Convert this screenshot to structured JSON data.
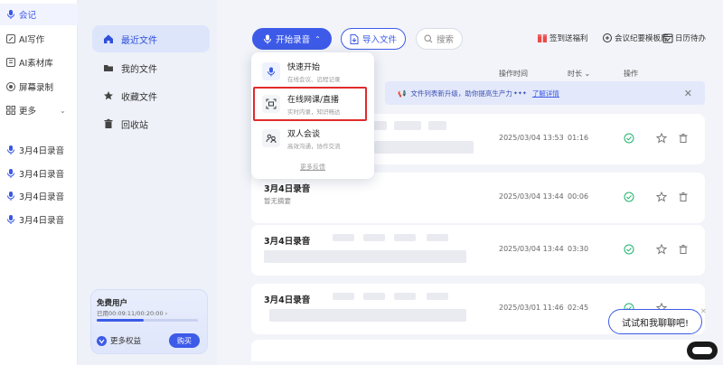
{
  "nav": {
    "items": [
      {
        "label": "会记",
        "icon": "mic-icon"
      },
      {
        "label": "AI写作",
        "icon": "edit-icon"
      },
      {
        "label": "AI素材库",
        "icon": "library-icon"
      },
      {
        "label": "屏幕录制",
        "icon": "record-icon"
      },
      {
        "label": "更多",
        "icon": "grid-icon"
      }
    ],
    "recordings": [
      "3月4日录音",
      "3月4日录音",
      "3月4日录音",
      "3月4日录音"
    ]
  },
  "col2": {
    "items": [
      {
        "label": "最近文件",
        "icon": "home-icon"
      },
      {
        "label": "我的文件",
        "icon": "folder-icon"
      },
      {
        "label": "收藏文件",
        "icon": "star-icon"
      },
      {
        "label": "回收站",
        "icon": "trash-icon"
      }
    ],
    "free_card": {
      "title": "免费用户",
      "usage": "已用00:09:11/00:20:00 ›",
      "usage_fraction": 0.46,
      "rights_label": "更多权益",
      "buy_label": "购买"
    }
  },
  "toolbar": {
    "record_label": "开始录音",
    "import_label": "导入文件",
    "search_placeholder": "搜索",
    "links": [
      "签到送福利",
      "会议纪要模板库",
      "日历待办"
    ]
  },
  "table": {
    "headers": {
      "time": "操作时间",
      "duration": "时长",
      "ops": "操作"
    }
  },
  "notice": {
    "text": "文件列表新升级，助你提高生产力",
    "link": "了解详情"
  },
  "dropdown": {
    "items": [
      {
        "title": "快速开始",
        "subtitle": "在线会议、远程记录"
      },
      {
        "title": "在线网课/直播",
        "subtitle": "实时内录，知识畅达"
      },
      {
        "title": "双人会谈",
        "subtitle": "高效沟通，协作交流"
      }
    ],
    "feedback": "更多反馈"
  },
  "rows": [
    {
      "title": "",
      "subtitle": "",
      "date": "2025/03/04 13:53",
      "duration": "01:16"
    },
    {
      "title": "3月4日录音",
      "subtitle": "暂无摘要",
      "date": "2025/03/04 13:44",
      "duration": "00:06"
    },
    {
      "title": "3月4日录音",
      "subtitle": "",
      "date": "2025/03/04 13:44",
      "duration": "03:30"
    },
    {
      "title": "3月4日录音",
      "subtitle": "",
      "date": "2025/03/01 11:46",
      "duration": "02:45"
    }
  ],
  "chat": {
    "label": "试试和我聊聊吧!"
  },
  "colors": {
    "accent": "#3d5be8",
    "highlight": "#e12b2b"
  }
}
